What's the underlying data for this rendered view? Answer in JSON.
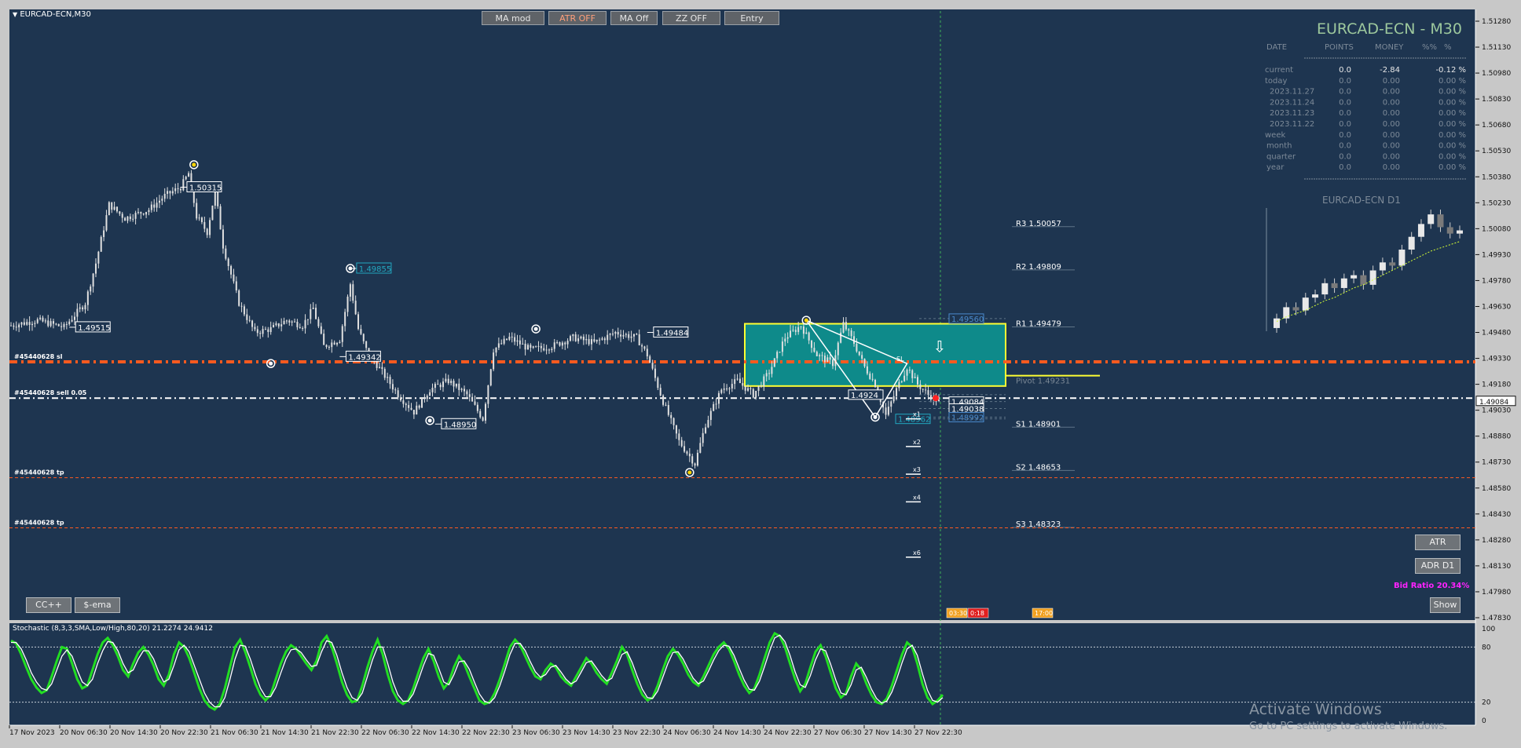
{
  "window": {
    "title": "EURCAD-ECN,M30"
  },
  "toolbar": {
    "buttons": [
      {
        "label": "MA mod",
        "color": "#e6e6e6"
      },
      {
        "label": "ATR OFF",
        "color": "#ff9f7a"
      },
      {
        "label": "MA Off",
        "color": "#e6e6e6"
      },
      {
        "label": "ZZ OFF",
        "color": "#e6e6e6"
      },
      {
        "label": "Entry",
        "color": "#e6e6e6"
      }
    ]
  },
  "bottom_buttons": {
    "cc": "CC++",
    "sema": "$-ema"
  },
  "side_buttons": {
    "atr": "ATR",
    "adr": "ADR D1",
    "show": "Show"
  },
  "bid_ratio": "Bid Ratio 20.34%",
  "symbol_heading": "EURCAD-ECN - M30",
  "mini_chart_title": "EURCAD-ECN D1",
  "stats": {
    "headers": [
      "DATE",
      "POINTS",
      "MONEY",
      "%%",
      "%"
    ],
    "rows": [
      {
        "label": "current",
        "points": "0.0",
        "money": "-2.84",
        "pct": "-0.12 %"
      },
      {
        "label": "today",
        "points": "0.0",
        "money": "0.00",
        "pct": "0.00 %"
      },
      {
        "label": "2023.11.27",
        "points": "0.0",
        "money": "0.00",
        "pct": "0.00 %"
      },
      {
        "label": "2023.11.24",
        "points": "0.0",
        "money": "0.00",
        "pct": "0.00 %"
      },
      {
        "label": "2023.11.23",
        "points": "0.0",
        "money": "0.00",
        "pct": "0.00 %"
      },
      {
        "label": "2023.11.22",
        "points": "0.0",
        "money": "0.00",
        "pct": "0.00 %"
      },
      {
        "label": "week",
        "points": "0.0",
        "money": "0.00",
        "pct": "0.00 %"
      },
      {
        "label": "month",
        "points": "0.0",
        "money": "0.00",
        "pct": "0.00 %"
      },
      {
        "label": "quarter",
        "points": "0.0",
        "money": "0.00",
        "pct": "0.00 %"
      },
      {
        "label": "year",
        "points": "0.0",
        "money": "0.00",
        "pct": "0.00 %"
      }
    ]
  },
  "stochastic_label": "Stochastic (8,3,3,SMA,Low/High,80,20) 21.2274 24.9412",
  "watermark": {
    "line1": "Activate Windows",
    "line2": "Go to PC settings to activate Windows."
  },
  "colors": {
    "background": "#1e3550",
    "frame": "#c8c8c8",
    "candle": "#e0e0e0",
    "entry_line": "#ff5a1f",
    "zone_fill": "#0e8a8a",
    "zone_border": "#ffff33",
    "stoch_main": "#22dd22",
    "stoch_signal": "#ffffff",
    "label_cyan": "#22a8c0",
    "label_blue": "#4a8acd",
    "magenta": "#ff22ff",
    "heading": "#9dc89d"
  },
  "chart_data": {
    "type": "candlestick",
    "symbol": "EURCAD-ECN",
    "timeframe": "M30",
    "ylim": [
      1.4783,
      1.5128
    ],
    "price_ticks": [
      "1.51280",
      "1.51130",
      "1.50980",
      "1.50830",
      "1.50680",
      "1.50530",
      "1.50380",
      "1.50230",
      "1.50080",
      "1.49930",
      "1.49780",
      "1.49630",
      "1.49480",
      "1.49330",
      "1.49180",
      "1.49030",
      "1.48880",
      "1.48730",
      "1.48580",
      "1.48430",
      "1.48280",
      "1.48130",
      "1.47980",
      "1.47830"
    ],
    "time_ticks": [
      "17 Nov 2023",
      "20 Nov 06:30",
      "20 Nov 14:30",
      "20 Nov 22:30",
      "21 Nov 06:30",
      "21 Nov 14:30",
      "21 Nov 22:30",
      "22 Nov 06:30",
      "22 Nov 14:30",
      "22 Nov 22:30",
      "23 Nov 06:30",
      "23 Nov 14:30",
      "23 Nov 22:30",
      "24 Nov 06:30",
      "24 Nov 14:30",
      "24 Nov 22:30",
      "27 Nov 06:30",
      "27 Nov 14:30",
      "27 Nov 22:30"
    ],
    "current_bid": "1.49084",
    "price_path": [
      [
        0,
        1.4952
      ],
      [
        10,
        1.4955
      ],
      [
        20,
        1.4951
      ],
      [
        28,
        1.4965
      ],
      [
        32,
        1.4988
      ],
      [
        37,
        1.5022
      ],
      [
        43,
        1.5014
      ],
      [
        52,
        1.5019
      ],
      [
        58,
        1.5027
      ],
      [
        64,
        1.5032
      ],
      [
        67,
        1.504
      ],
      [
        70,
        1.5015
      ],
      [
        74,
        1.5006
      ],
      [
        77,
        1.503
      ],
      [
        80,
        1.4998
      ],
      [
        86,
        1.4965
      ],
      [
        92,
        1.4948
      ],
      [
        98,
        1.495
      ],
      [
        104,
        1.4955
      ],
      [
        110,
        1.4952
      ],
      [
        114,
        1.4962
      ],
      [
        118,
        1.494
      ],
      [
        124,
        1.4944
      ],
      [
        128,
        1.4976
      ],
      [
        131,
        1.495
      ],
      [
        134,
        1.4938
      ],
      [
        140,
        1.4925
      ],
      [
        146,
        1.4912
      ],
      [
        152,
        1.4902
      ],
      [
        158,
        1.4915
      ],
      [
        165,
        1.492
      ],
      [
        172,
        1.4912
      ],
      [
        178,
        1.4898
      ],
      [
        182,
        1.4938
      ],
      [
        188,
        1.4945
      ],
      [
        196,
        1.4938
      ],
      [
        204,
        1.494
      ],
      [
        212,
        1.4945
      ],
      [
        220,
        1.4942
      ],
      [
        228,
        1.4948
      ],
      [
        236,
        1.4945
      ],
      [
        240,
        1.4935
      ],
      [
        246,
        1.4908
      ],
      [
        252,
        1.4885
      ],
      [
        258,
        1.4872
      ],
      [
        262,
        1.4895
      ],
      [
        268,
        1.4915
      ],
      [
        274,
        1.492
      ],
      [
        280,
        1.4912
      ],
      [
        286,
        1.4925
      ],
      [
        292,
        1.4945
      ],
      [
        298,
        1.4952
      ],
      [
        304,
        1.4935
      ],
      [
        310,
        1.493
      ],
      [
        314,
        1.4953
      ],
      [
        318,
        1.4942
      ],
      [
        322,
        1.4928
      ],
      [
        326,
        1.4918
      ],
      [
        330,
        1.49
      ],
      [
        334,
        1.4915
      ],
      [
        338,
        1.4928
      ],
      [
        342,
        1.4918
      ],
      [
        346,
        1.4912
      ],
      [
        350,
        1.4908
      ]
    ],
    "swing_labels": [
      {
        "x": 64,
        "y": 1.5032,
        "text": "1.50315",
        "style": "white"
      },
      {
        "x": 22,
        "y": 1.4951,
        "text": "1.49515",
        "style": "white"
      },
      {
        "x": 128,
        "y": 1.4985,
        "text": "1.49855",
        "style": "cyan"
      },
      {
        "x": 124,
        "y": 1.4934,
        "text": "1.49342",
        "style": "white"
      },
      {
        "x": 160,
        "y": 1.4895,
        "text": "1.48950",
        "style": "white"
      },
      {
        "x": 240,
        "y": 1.4948,
        "text": "1.49484",
        "style": "white"
      }
    ],
    "swing_markers": [
      {
        "x": 69,
        "y": 1.5045,
        "style": "yellow"
      },
      {
        "x": 128,
        "y": 1.4985,
        "style": "white"
      },
      {
        "x": 98,
        "y": 1.493,
        "style": "white"
      },
      {
        "x": 158,
        "y": 1.4897,
        "style": "white"
      },
      {
        "x": 198,
        "y": 1.495,
        "style": "white"
      },
      {
        "x": 256,
        "y": 1.4867,
        "style": "yellow"
      },
      {
        "x": 300,
        "y": 1.4955,
        "style": "yellow"
      },
      {
        "x": 326,
        "y": 1.4899,
        "style": "white"
      }
    ],
    "pivots": [
      {
        "label": "R3 1.50057",
        "y": 1.5006
      },
      {
        "label": "R2 1.49809",
        "y": 1.4981
      },
      {
        "label": "R1 1.49479",
        "y": 1.4948
      },
      {
        "label": "Pivot 1.49231",
        "y": 1.4923
      },
      {
        "label": "S1 1.48901",
        "y": 1.489
      },
      {
        "label": "S2 1.48653",
        "y": 1.4865
      },
      {
        "label": "S3 1.48323",
        "y": 1.4832
      }
    ],
    "order_lines": [
      {
        "label": "#45440628 sl",
        "y": 1.4931,
        "style": "dashdot-thick"
      },
      {
        "label": "#45440628 sell 0.05",
        "y": 1.491,
        "style": "dashdot-white"
      },
      {
        "label": "#45440628 tp",
        "y": 1.4864,
        "style": "dashed"
      },
      {
        "label": "#45440628 tp",
        "y": 1.4835,
        "style": "dashed"
      }
    ],
    "zone": {
      "y_top": 1.4953,
      "y_bottom": 1.4917
    },
    "target_labels": [
      {
        "text": "1.49560",
        "y": 1.4956,
        "style": "blue"
      },
      {
        "text": "1.49084",
        "y": 1.4908,
        "style": "white"
      },
      {
        "text": "1.49038",
        "y": 1.4904,
        "style": "white"
      },
      {
        "text": "1.48992",
        "y": 1.4899,
        "style": "blue"
      },
      {
        "text": "1.48962",
        "y": 1.4898,
        "style": "cyan"
      },
      {
        "text": "1.4924",
        "y": 1.4912,
        "style": "white"
      }
    ],
    "x_targets": [
      "x1",
      "x2",
      "x3",
      "x4",
      "x6"
    ],
    "x_target_prices": [
      1.4898,
      1.4882,
      1.4866,
      1.485,
      1.4818
    ],
    "sl_mark": "SL",
    "time_markers": [
      "03:30",
      "0:18",
      "17:00"
    ],
    "mini_chart": {
      "type": "candlestick",
      "closes": [
        1.4953,
        1.496,
        1.4958,
        1.4966,
        1.4968,
        1.4975,
        1.4972,
        1.4978,
        1.498,
        1.4974,
        1.4983,
        1.4988,
        1.4986,
        1.4996,
        1.5004,
        1.5012,
        1.5018,
        1.501,
        1.5006,
        1.5008
      ],
      "ma": [
        1.4954,
        1.4957,
        1.4959,
        1.4961,
        1.4964,
        1.4967,
        1.4969,
        1.4972,
        1.4975,
        1.4977,
        1.498,
        1.4983,
        1.4986,
        1.4989,
        1.4992,
        1.4995,
        1.4998,
        1.5,
        1.5002,
        1.5004
      ]
    },
    "stochastic": {
      "ylim": [
        0,
        100
      ],
      "levels": [
        "100",
        "80",
        "20",
        "0"
      ],
      "main": [
        87,
        84,
        72,
        58,
        45,
        36,
        30,
        33,
        48,
        65,
        80,
        78,
        62,
        45,
        35,
        38,
        55,
        72,
        85,
        90,
        82,
        70,
        55,
        48,
        62,
        74,
        80,
        72,
        60,
        45,
        38,
        50,
        72,
        85,
        80,
        68,
        52,
        35,
        22,
        15,
        12,
        18,
        35,
        58,
        80,
        88,
        75,
        58,
        40,
        28,
        22,
        28,
        45,
        62,
        75,
        82,
        78,
        70,
        62,
        55,
        65,
        85,
        92,
        80,
        62,
        42,
        28,
        20,
        22,
        38,
        58,
        75,
        88,
        72,
        50,
        32,
        22,
        18,
        22,
        35,
        52,
        68,
        78,
        65,
        48,
        35,
        42,
        58,
        70,
        62,
        48,
        35,
        22,
        18,
        20,
        30,
        45,
        62,
        80,
        88,
        82,
        70,
        58,
        48,
        45,
        55,
        62,
        58,
        48,
        42,
        38,
        48,
        58,
        68,
        62,
        52,
        45,
        40,
        52,
        65,
        80,
        72,
        55,
        40,
        28,
        22,
        25,
        38,
        55,
        70,
        78,
        72,
        62,
        50,
        42,
        38,
        48,
        60,
        72,
        80,
        85,
        78,
        65,
        50,
        38,
        30,
        35,
        50,
        68,
        85,
        95,
        92,
        80,
        62,
        45,
        32,
        40,
        58,
        75,
        82,
        70,
        52,
        35,
        25,
        30,
        48,
        62,
        55,
        40,
        28,
        20,
        18,
        24,
        38,
        55,
        72,
        85,
        80,
        62,
        40,
        25,
        18,
        22,
        28
      ],
      "signal": [
        85,
        85,
        78,
        66,
        52,
        42,
        35,
        33,
        40,
        55,
        70,
        77,
        70,
        55,
        42,
        38,
        45,
        62,
        76,
        86,
        85,
        76,
        62,
        52,
        55,
        67,
        76,
        76,
        67,
        53,
        42,
        45,
        60,
        77,
        82,
        75,
        60,
        45,
        30,
        20,
        15,
        15,
        25,
        45,
        67,
        82,
        81,
        67,
        50,
        35,
        26,
        26,
        36,
        52,
        67,
        77,
        78,
        74,
        66,
        59,
        60,
        75,
        87,
        85,
        71,
        52,
        36,
        25,
        22,
        30,
        48,
        66,
        80,
        80,
        62,
        42,
        28,
        21,
        21,
        29,
        44,
        60,
        73,
        71,
        57,
        42,
        39,
        50,
        64,
        65,
        56,
        42,
        29,
        21,
        19,
        25,
        38,
        54,
        72,
        84,
        84,
        76,
        64,
        53,
        47,
        50,
        58,
        60,
        53,
        45,
        40,
        43,
        53,
        63,
        65,
        57,
        49,
        43,
        46,
        59,
        72,
        75,
        63,
        48,
        34,
        25,
        24,
        32,
        47,
        62,
        74,
        75,
        67,
        56,
        46,
        40,
        43,
        54,
        66,
        76,
        82,
        81,
        71,
        57,
        44,
        34,
        33,
        43,
        59,
        76,
        90,
        93,
        86,
        71,
        53,
        39,
        36,
        49,
        66,
        78,
        76,
        61,
        44,
        30,
        28,
        39,
        55,
        58,
        47,
        34,
        24,
        19,
        21,
        31,
        46,
        63,
        78,
        82,
        71,
        51,
        33,
        22,
        20,
        25
      ]
    }
  }
}
